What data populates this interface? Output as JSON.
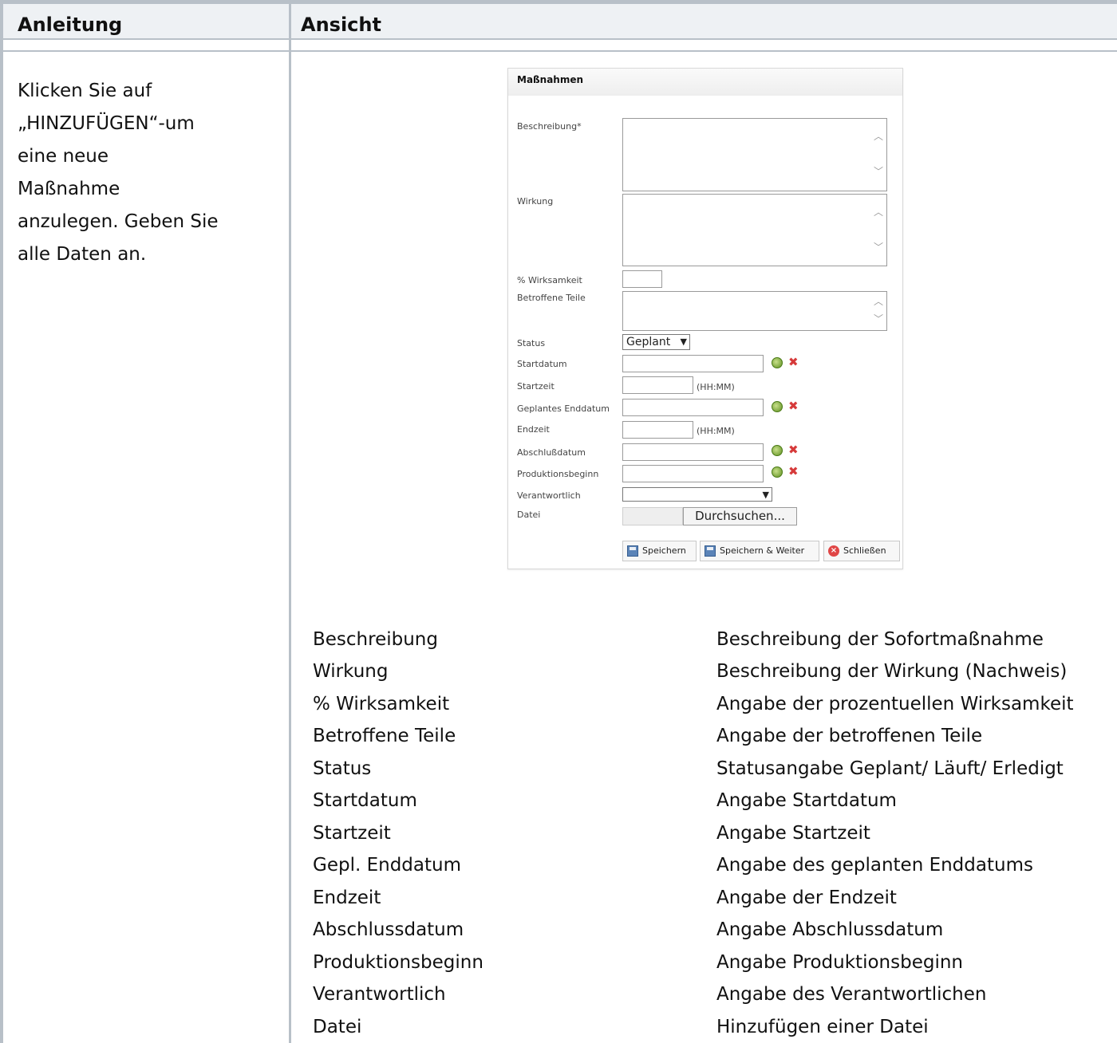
{
  "header": {
    "col1": "Anleitung",
    "col2": "Ansicht"
  },
  "instruction": {
    "lines": [
      "Klicken Sie auf",
      "„HINZUFÜGEN“-um",
      "eine neue",
      "Maßnahme",
      "anzulegen. Geben Sie",
      "alle Daten an."
    ]
  },
  "form": {
    "title": "Maßnahmen",
    "labels": {
      "beschreibung": "Beschreibung*",
      "wirkung": "Wirkung",
      "wirksamkeit": "% Wirksamkeit",
      "teile": "Betroffene Teile",
      "status": "Status",
      "startdatum": "Startdatum",
      "startzeit": "Startzeit",
      "enddatum": "Geplantes Enddatum",
      "endzeit": "Endzeit",
      "abschluss": "Abschlußdatum",
      "produktion": "Produktionsbeginn",
      "verantwortlich": "Verantwortlich",
      "datei": "Datei"
    },
    "status_value": "Geplant",
    "time_hint": "(HH:MM)",
    "browse_label": "Durchsuchen...",
    "buttons": {
      "save": "Speichern",
      "save_next": "Speichern & Weiter",
      "close": "Schließen"
    },
    "icons": {
      "picker": "date-picker-icon",
      "clear": "clear-icon",
      "save": "floppy-disk-icon",
      "close": "close-circle-icon"
    }
  },
  "fields": [
    {
      "name": "Beschreibung",
      "desc": "Beschreibung der Sofortmaßnahme"
    },
    {
      "name": "Wirkung",
      "desc": "Beschreibung der Wirkung (Nachweis)"
    },
    {
      "name": "% Wirksamkeit",
      "desc": "Angabe der prozentuellen Wirksamkeit"
    },
    {
      "name": "Betroffene Teile",
      "desc": "Angabe der betroffenen Teile"
    },
    {
      "name": "Status",
      "desc": "Statusangabe Geplant/ Läuft/ Erledigt"
    },
    {
      "name": "Startdatum",
      "desc": "Angabe Startdatum"
    },
    {
      "name": "Startzeit",
      "desc": "Angabe Startzeit"
    },
    {
      "name": "Gepl. Enddatum",
      "desc": "Angabe des geplanten Enddatums"
    },
    {
      "name": "Endzeit",
      "desc": "Angabe der Endzeit"
    },
    {
      "name": "Abschlussdatum",
      "desc": "Angabe Abschlussdatum"
    },
    {
      "name": "Produktionsbeginn",
      "desc": "Angabe Produktionsbeginn"
    },
    {
      "name": "Verantwortlich",
      "desc": "Angabe des Verantwortlichen"
    },
    {
      "name": "Datei",
      "desc": "Hinzufügen einer Datei"
    }
  ]
}
